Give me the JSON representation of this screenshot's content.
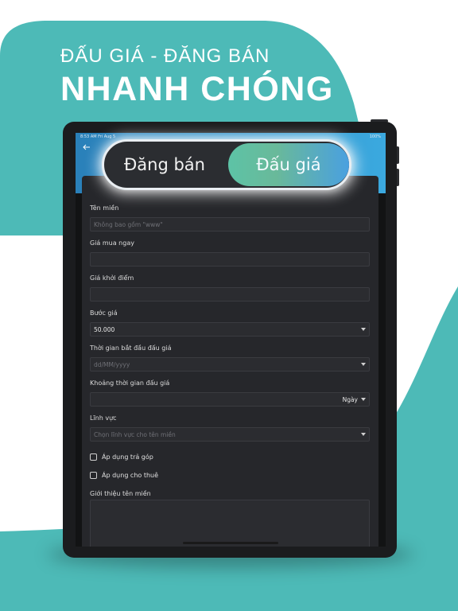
{
  "hero": {
    "subtitle": "ĐẤU GIÁ - ĐĂNG BÁN",
    "title": "NHANH CHÓNG"
  },
  "colors": {
    "teal": "#4dbab7",
    "device": "#1b1c1e",
    "header_blue": "#3ba9df",
    "card": "#26272b",
    "toggle_gradient_start": "#5dc3a6",
    "toggle_gradient_end": "#4aa0e0"
  },
  "status_bar": {
    "time": "8:53 AM   Fri Aug 5",
    "right": "100%"
  },
  "toggle": {
    "left_label": "Đăng bán",
    "right_label": "Đấu giá",
    "active": "Đấu giá"
  },
  "form": {
    "domain_name": {
      "label": "Tên miền",
      "placeholder": "Không bao gồm \"www\""
    },
    "buy_now_price": {
      "label": "Giá mua ngay",
      "value": ""
    },
    "starting_price": {
      "label": "Giá khởi điểm",
      "value": ""
    },
    "bid_step": {
      "label": "Bước giá",
      "value": "50.000"
    },
    "start_time": {
      "label": "Thời gian bắt đầu đấu giá",
      "placeholder": "dd/MM/yyyy"
    },
    "duration": {
      "label": "Khoảng thời gian đấu giá",
      "unit": "Ngày"
    },
    "category": {
      "label": "Lĩnh vực",
      "placeholder": "Chọn lĩnh vực cho tên miền"
    },
    "installment": {
      "label": "Áp dụng trả góp",
      "checked": false
    },
    "rental": {
      "label": "Áp dụng cho thuê",
      "checked": false
    },
    "description": {
      "label": "Giới thiệu tên miền",
      "value": ""
    }
  },
  "icons": {
    "back": "arrow-left-icon",
    "dropdown": "caret-down-icon",
    "checkbox": "checkbox-icon"
  }
}
